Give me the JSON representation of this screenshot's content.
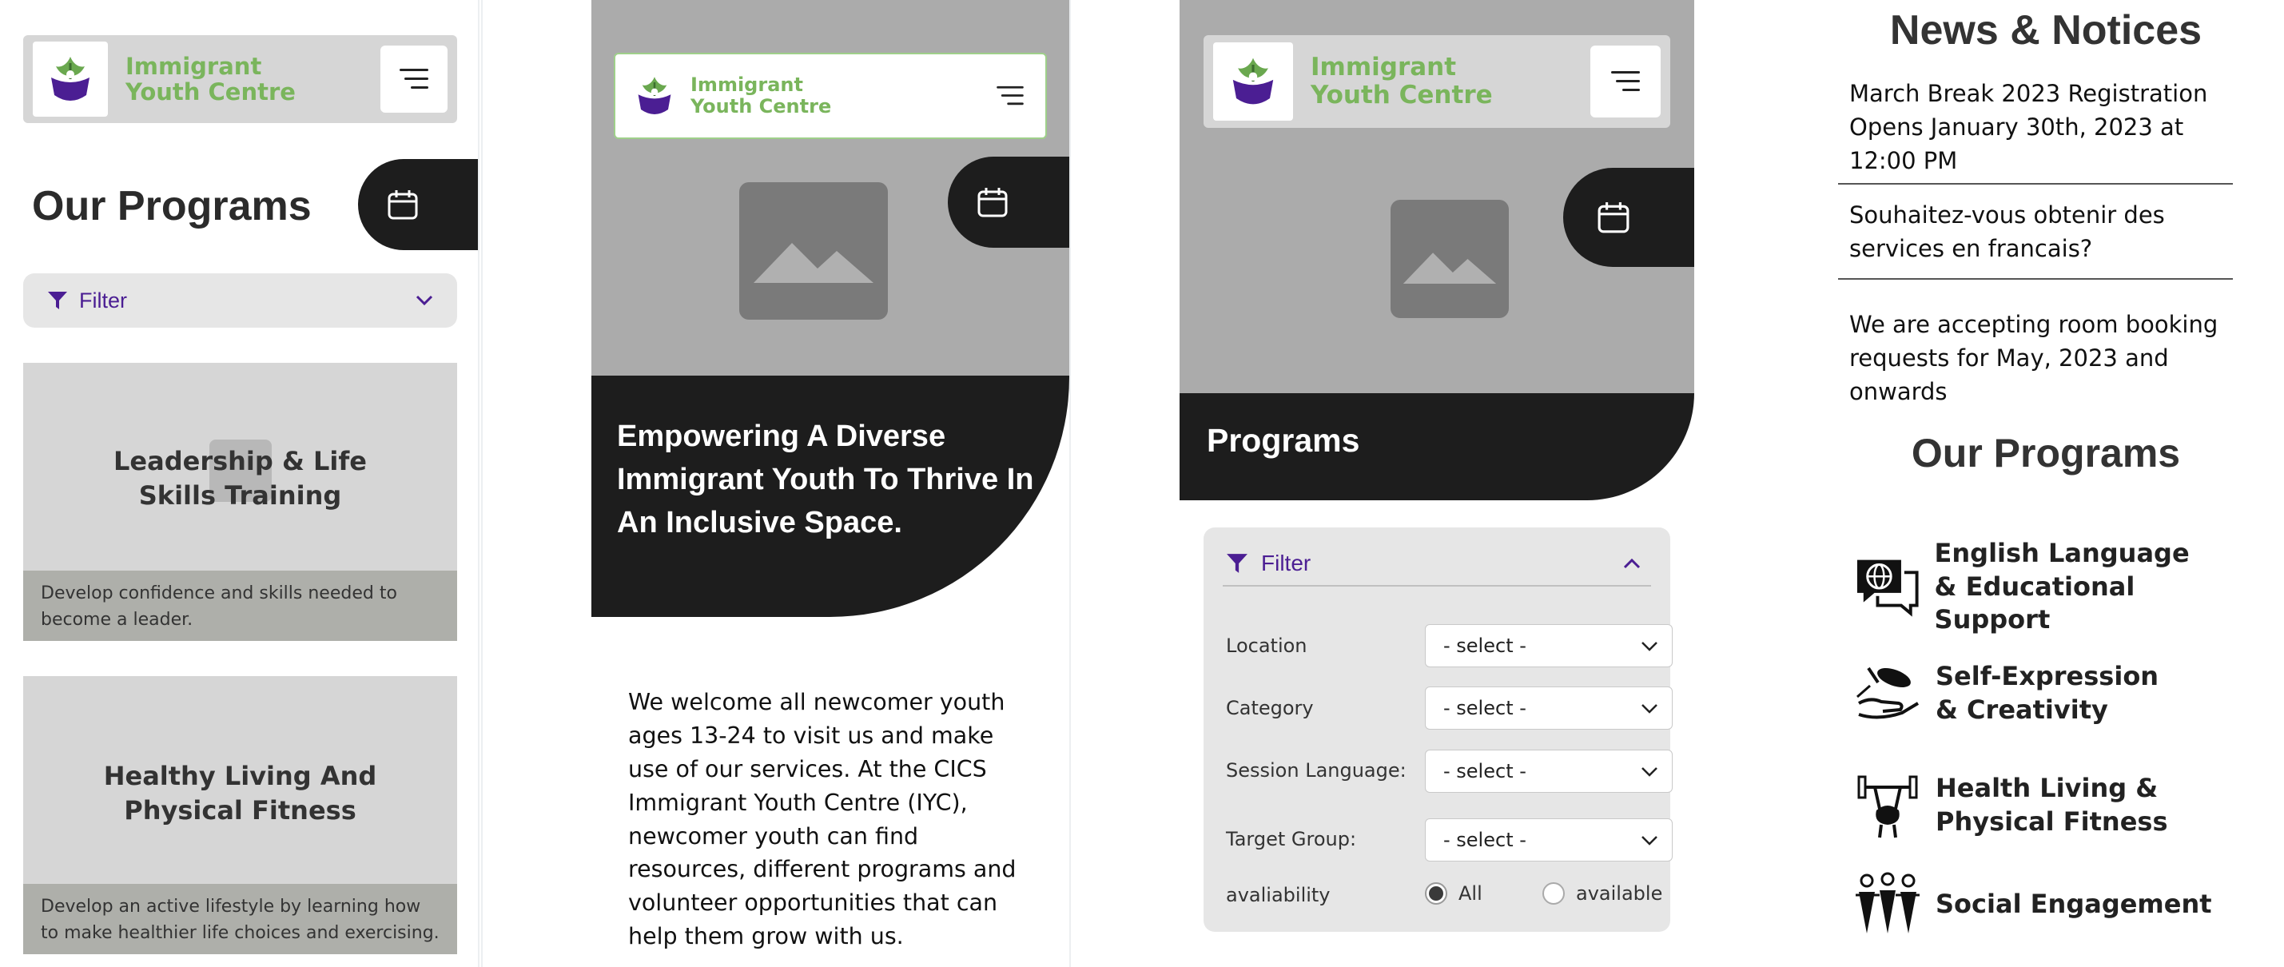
{
  "brand": {
    "line1": "Immigrant",
    "line2": "Youth Centre",
    "green": "#7ab55c",
    "purple": "#4b1e93",
    "dark": "#1d1d1d"
  },
  "icons": {
    "menu": "menu-icon",
    "calendar": "calendar-icon",
    "filter": "filter-icon",
    "chevron_down": "chevron-down-icon",
    "chevron_up": "chevron-up-icon",
    "image": "image-placeholder-icon"
  },
  "panel1": {
    "title": "Our Programs",
    "filter_label": "Filter",
    "cards": [
      {
        "title": "Leadership & Life Skills Training",
        "desc": "Develop confidence and skills needed to become a leader."
      },
      {
        "title": "Healthy Living And Physical Fitness",
        "desc": "Develop an active lifestyle by learning how to make healthier life choices and exercising."
      }
    ]
  },
  "panel2": {
    "hero_title": "Empowering A Diverse Immigrant Youth To Thrive In An Inclusive Space.",
    "intro": "We welcome all newcomer youth ages 13-24 to visit us and make use of our services. At the CICS Immigrant Youth Centre (IYC), newcomer youth can find resources, different programs and volunteer opportunities that can help them grow with us."
  },
  "panel3": {
    "hero_title": "Programs",
    "filter_label": "Filter",
    "fields": [
      {
        "label": "Location",
        "value": "- select -"
      },
      {
        "label": "Category",
        "value": "- select -"
      },
      {
        "label": "Session Language:",
        "value": "- select -"
      },
      {
        "label": "Target Group:",
        "value": "- select -"
      }
    ],
    "availability": {
      "label": "avaliability",
      "options": [
        "All",
        "available"
      ],
      "selected": "All"
    }
  },
  "panel4": {
    "news_title": "News & Notices",
    "news": [
      "March Break 2023 Registration Opens January 30th, 2023 at 12:00 PM",
      "Souhaitez-vous obtenir des services en francais?",
      "We are accepting room booking requests for May, 2023 and onwards"
    ],
    "programs_title": "Our Programs",
    "programs": [
      {
        "line1": "English Language",
        "line2": "& Educational Support",
        "icon": "language-chat-icon"
      },
      {
        "line1": "Self-Expression",
        "line2": "& Creativity",
        "icon": "creativity-hand-icon"
      },
      {
        "line1": "Health Living &",
        "line2": "Physical Fitness",
        "icon": "fitness-weights-icon"
      },
      {
        "line1": "Social Engagement",
        "line2": "",
        "icon": "people-group-icon"
      }
    ]
  }
}
